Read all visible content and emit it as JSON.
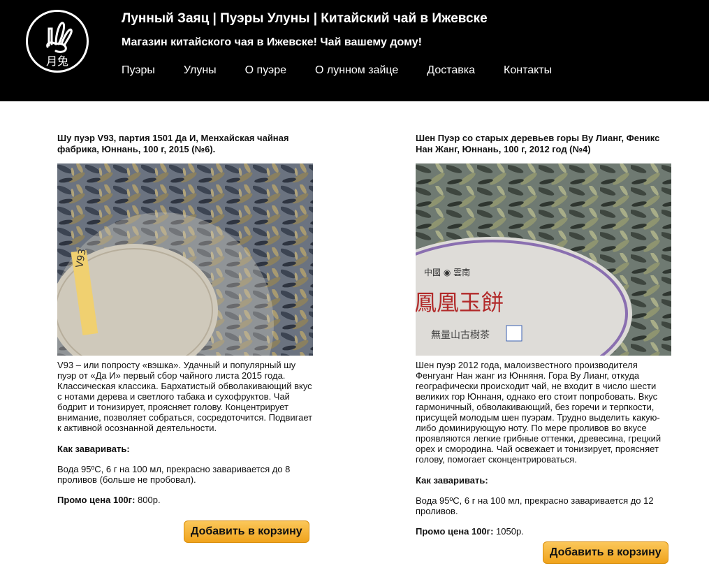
{
  "header": {
    "logo_text": "月兔",
    "title": "Лунный Заяц | Пуэры Улуны | Китайский чай в Ижевске",
    "tagline": "Магазин китайского чая в Ижевске! Чай вашему дому!",
    "nav": [
      "Пуэры",
      "Улуны",
      "О пуэре",
      "О лунном зайце",
      "Доставка",
      "Контакты"
    ]
  },
  "products": [
    {
      "title": "Шу пуэр V93, партия 1501 Да И, Менхайская чайная фабрика, Юннань, 100 г, 2015 (№6).",
      "image_wrapper_text": "V93",
      "description": "V93 – или попросту «вэшка». Удачный и популярный шу пуэр от «Да И» первый сбор чайного листа 2015 года. Классическая классика. Бархатистый обволакивающий вкус с нотами дерева и светлого табака и сухофруктов. Чай бодрит и тонизирует, проясняет голову. Концентрирует внимание, позволяет собраться, сосредоточится. Подвигает к активной осознанной деятельности.",
      "howto_label": "Как заваривать:",
      "brew": "Вода 95ºC, 6 г на 100 мл, прекрасно заваривается до 8 проливов (больше не пробовал).",
      "price_label": "Промо цена 100г:",
      "price": " 800р.",
      "button": "Добавить в корзину"
    },
    {
      "title": "Шен Пуэр со старых деревьев горы Ву Лианг, Феникс Нан Жанг, Юннань, 100 г, 2012 год (№4)",
      "image_wrapper_text": "鳳凰玉餅",
      "description": "Шен пуэр 2012 года, малоизвестного производителя Фенгуанг Нан жанг из Юнняня. Гора Ву Лианг, откуда географически происходит чай, не входит в число шести великих гор Юннаня, однако его стоит попробовать. Вкус гармоничный, обволакивающий, без горечи и терпкости, присущей молодым шен пуэрам. Трудно выделить какую-либо доминирующую ноту. По мере проливов во вкусе проявляются легкие грибные оттенки, древесина, грецкий орех и смородина. Чай освежает и тонизирует, проясняет голову, помогает сконцентрироваться.",
      "howto_label": "Как заваривать:",
      "brew": "Вода 95ºC, 6 г на 100 мл, прекрасно заваривается до 12 проливов.",
      "price_label": "Промо цена 100г:",
      "price": " 1050р.",
      "button": "Добавить в корзину"
    }
  ]
}
